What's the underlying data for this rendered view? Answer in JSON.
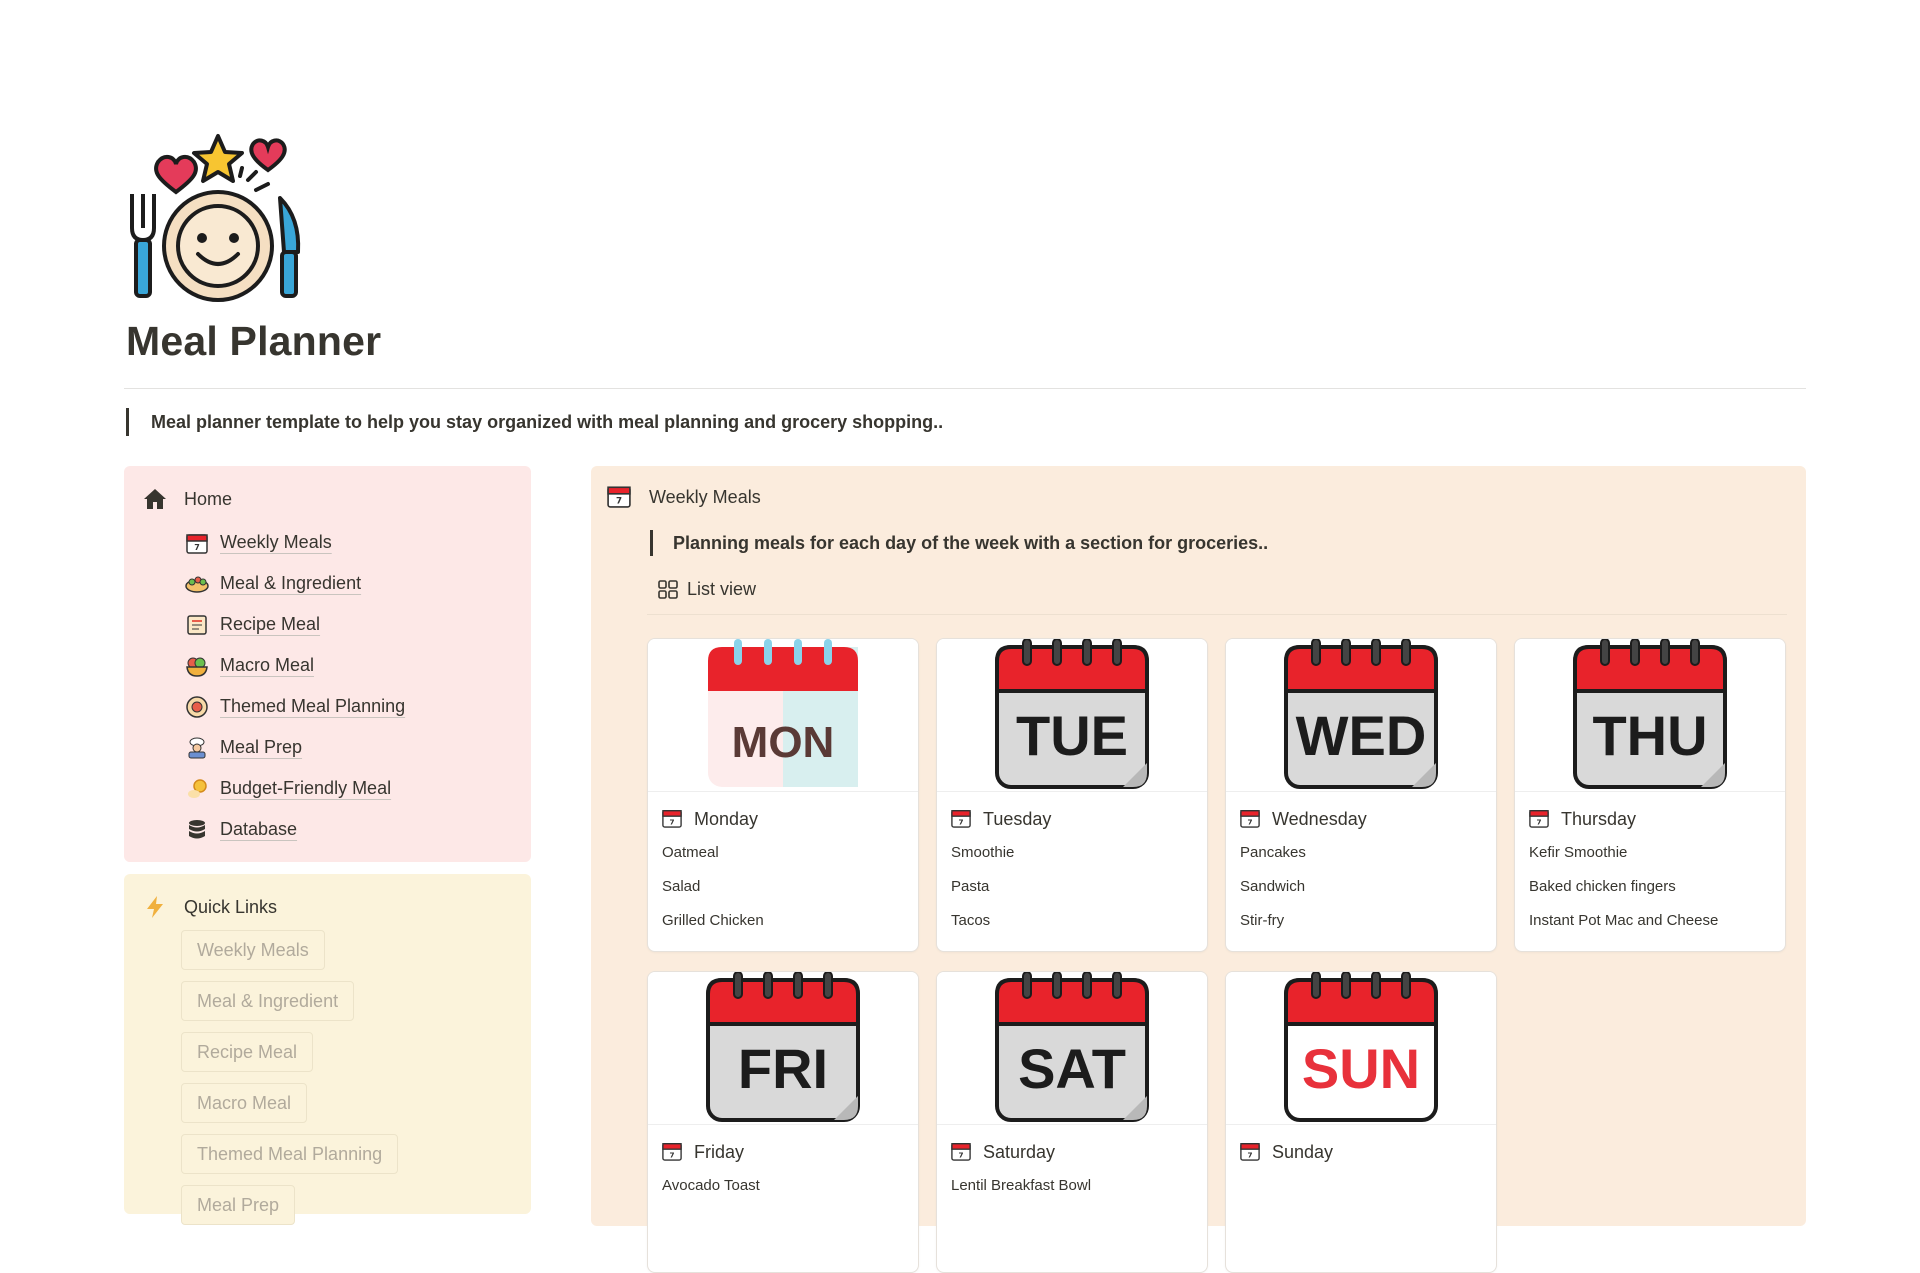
{
  "page": {
    "title": "Meal Planner",
    "description": "Meal planner template to help you stay organized with meal planning and grocery shopping.."
  },
  "home": {
    "label": "Home",
    "items": [
      {
        "label": "Weekly Meals",
        "icon": "calendar-icon"
      },
      {
        "label": "Meal & Ingredient",
        "icon": "salad-bowl-icon"
      },
      {
        "label": "Recipe Meal",
        "icon": "recipe-book-icon"
      },
      {
        "label": "Macro Meal",
        "icon": "macro-bowl-icon"
      },
      {
        "label": "Themed Meal Planning",
        "icon": "themed-plate-icon"
      },
      {
        "label": "Meal Prep",
        "icon": "chef-icon"
      },
      {
        "label": "Budget-Friendly Meal",
        "icon": "coin-icon"
      },
      {
        "label": "Database",
        "icon": "database-icon"
      }
    ]
  },
  "quick_links": {
    "label": "Quick Links",
    "items": [
      "Weekly Meals",
      "Meal & Ingredient",
      "Recipe Meal",
      "Macro Meal",
      "Themed Meal Planning",
      "Meal Prep"
    ]
  },
  "weekly": {
    "title": "Weekly Meals",
    "description": "Planning meals for each day of the week with a section for groceries..",
    "view_label": "List view",
    "days": [
      {
        "cover": "MON",
        "name": "Monday",
        "meals": [
          "Oatmeal",
          "Salad",
          "Grilled Chicken"
        ]
      },
      {
        "cover": "TUE",
        "name": "Tuesday",
        "meals": [
          "Smoothie",
          "Pasta",
          "Tacos"
        ]
      },
      {
        "cover": "WED",
        "name": "Wednesday",
        "meals": [
          "Pancakes",
          "Sandwich",
          "Stir-fry"
        ]
      },
      {
        "cover": "THU",
        "name": "Thursday",
        "meals": [
          "Kefir Smoothie",
          "Baked chicken fingers",
          "Instant Pot Mac and Cheese"
        ]
      },
      {
        "cover": "FRI",
        "name": "Friday",
        "meals": [
          "Avocado Toast"
        ]
      },
      {
        "cover": "SAT",
        "name": "Saturday",
        "meals": [
          "Lentil Breakfast Bowl"
        ]
      },
      {
        "cover": "SUN",
        "name": "Sunday",
        "meals": []
      }
    ]
  },
  "colors": {
    "home_panel": "#fde8e7",
    "quick_panel": "#fbf3db",
    "weekly_panel": "#fbecdd",
    "calendar_red": "#e8232b",
    "sun_text": "#e8313b"
  }
}
